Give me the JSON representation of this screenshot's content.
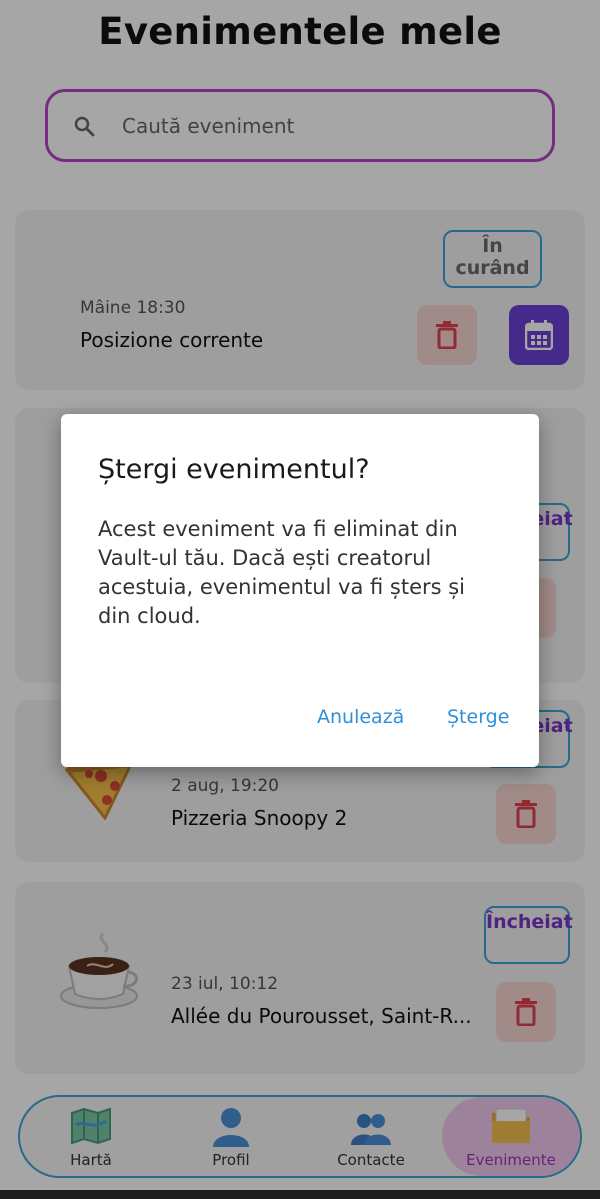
{
  "header": {
    "title": "Evenimentele mele"
  },
  "search": {
    "placeholder": "Caută eveniment",
    "icon": "search-icon"
  },
  "events": [
    {
      "status": "În curând",
      "datetime": "Mâine 18:30",
      "place": "Posizione corrente"
    },
    {
      "status": "Încheiat",
      "datetime": "",
      "place": ""
    },
    {
      "status": "Încheiat",
      "datetime": "2 aug, 19:20",
      "place": "Pizzeria Snoopy 2",
      "thumbnail": "pizza-icon"
    },
    {
      "status": "Încheiat",
      "datetime": "23 iul, 10:12",
      "place": "Allée du Pourousset, Saint-R...",
      "thumbnail": "coffee-icon"
    }
  ],
  "nav": {
    "items": [
      {
        "label": "Hartă",
        "icon": "map-icon"
      },
      {
        "label": "Profil",
        "icon": "person-icon"
      },
      {
        "label": "Contacte",
        "icon": "people-icon"
      },
      {
        "label": "Evenimente",
        "icon": "folder-icon",
        "active": true
      }
    ]
  },
  "dialog": {
    "title": "Ștergi evenimentul?",
    "body": "Acest eveniment va fi eliminat din Vault-ul tău. Dacă ești creatorul acestuia, evenimentul va fi șters și din cloud.",
    "cancel": "Anulează",
    "confirm": "Șterge"
  },
  "colors": {
    "accent": "#b743c8",
    "outline": "#3ba7d4",
    "calendar": "#6a3fd6",
    "trash_bg": "#f7d6d3",
    "trash": "#e0414f",
    "link": "#2f8fd8"
  }
}
